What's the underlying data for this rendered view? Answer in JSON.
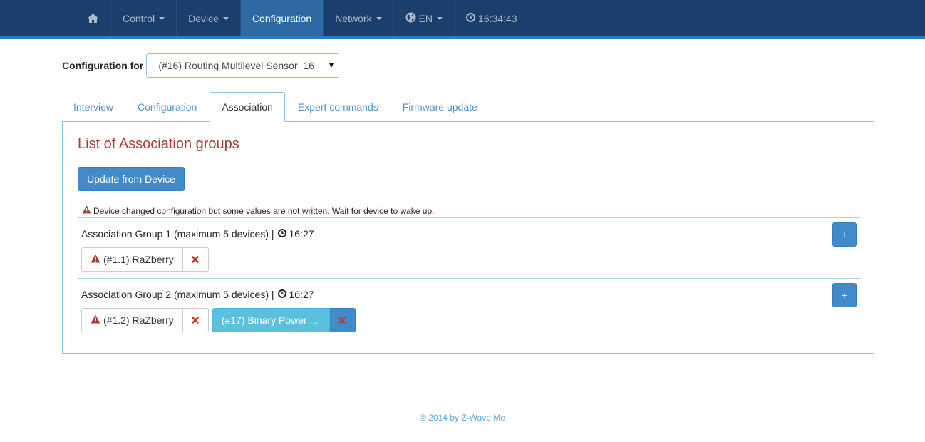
{
  "nav": {
    "home_icon": "home-icon",
    "control": "Control",
    "device": "Device",
    "configuration": "Configuration",
    "network": "Network",
    "language": "EN",
    "language_icon": "globe-icon",
    "clock_icon": "clock-icon",
    "time": "16:34:43"
  },
  "config": {
    "label": "Configuration for",
    "selected_device": "(#16) Routing Multilevel Sensor_16"
  },
  "tabs": [
    {
      "label": "Interview"
    },
    {
      "label": "Configuration"
    },
    {
      "label": "Association",
      "active": true
    },
    {
      "label": "Expert commands"
    },
    {
      "label": "Firmware update"
    }
  ],
  "panel": {
    "title": "List of Association groups",
    "update_button": "Update from Device",
    "warning": "Device changed configuration but some values are not written. Wait for device to wake up."
  },
  "groups": [
    {
      "title": "Association Group 1 (maximum 5 devices) |",
      "time": "16:27",
      "add_label": "+",
      "members": [
        {
          "label": "(#1.1) RaZberry",
          "status": "warning"
        }
      ]
    },
    {
      "title": "Association Group 2 (maximum 5 devices) |",
      "time": "16:27",
      "add_label": "+",
      "members": [
        {
          "label": "(#1.2) RaZberry",
          "status": "warning"
        },
        {
          "label": "(#17) Binary Power ...",
          "status": "info"
        }
      ]
    }
  ],
  "footer": "© 2014 by Z-Wave.Me",
  "colors": {
    "navbar": "#1b3f6c",
    "nav_active": "#2d6aa3",
    "primary": "#428bca",
    "info": "#5bc0de",
    "title_red": "#a63a3a",
    "danger": "#c9302c",
    "link": "#4a93c9"
  }
}
